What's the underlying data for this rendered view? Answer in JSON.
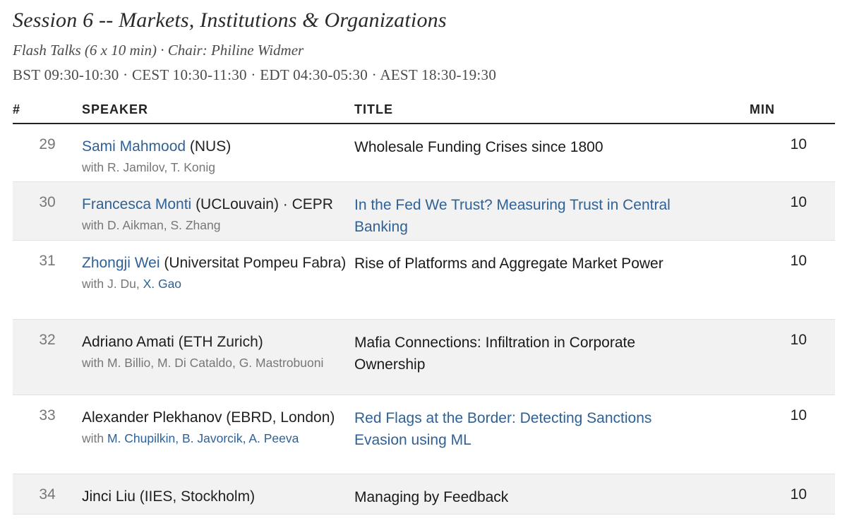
{
  "session": {
    "title": "Session 6 -- Markets, Institutions & Organizations",
    "subtitle": "Flash Talks (6 x 10 min) · Chair: Philine Widmer",
    "times": "BST 09:30-10:30 · CEST 10:30-11:30 · EDT 04:30-05:30 · AEST 18:30-19:30"
  },
  "table": {
    "headers": {
      "num": "#",
      "speaker": "SPEAKER",
      "title": "TITLE",
      "min": "MIN"
    },
    "rows": [
      {
        "num": "29",
        "speaker": "Sami Mahmood",
        "speaker_linked": true,
        "affiliation": " (NUS)",
        "with_prefix": "with ",
        "coauthors": "R. Jamilov, T. Konig",
        "coauthors_linked": false,
        "title": "Wholesale Funding Crises since 1800",
        "title_linked": false,
        "min": "10"
      },
      {
        "num": "30",
        "speaker": "Francesca Monti",
        "speaker_linked": true,
        "affiliation": " (UCLouvain) · CEPR",
        "with_prefix": "with ",
        "coauthors": "D. Aikman, S. Zhang",
        "coauthors_linked": false,
        "title": "In the Fed We Trust? Measuring Trust in Central Banking",
        "title_linked": true,
        "min": "10"
      },
      {
        "num": "31",
        "speaker": "Zhongji Wei",
        "speaker_linked": true,
        "affiliation": " (Universitat Pompeu Fabra)",
        "with_prefix": "with ",
        "coauthors": "J. Du, ",
        "coauthors_linked": false,
        "coauthors_link_part": "X. Gao",
        "title": "Rise of Platforms and Aggregate Market Power",
        "title_linked": false,
        "min": "10"
      },
      {
        "num": "32",
        "speaker": "Adriano Amati",
        "speaker_linked": false,
        "affiliation": " (ETH Zurich)",
        "with_prefix": "with ",
        "coauthors": "M. Billio, M. Di Cataldo, G. Mastrobuoni",
        "coauthors_linked": false,
        "title": "Mafia Connections: Infiltration in Corporate Ownership",
        "title_linked": false,
        "min": "10"
      },
      {
        "num": "33",
        "speaker": "Alexander Plekhanov",
        "speaker_linked": false,
        "affiliation": " (EBRD, London)",
        "with_prefix": "with ",
        "coauthors": "M. Chupilkin, B. Javorcik, A. Peeva",
        "coauthors_linked": true,
        "title": "Red Flags at the Border: Detecting Sanctions Evasion using ML",
        "title_linked": true,
        "min": "10"
      },
      {
        "num": "34",
        "speaker": "Jinci Liu",
        "speaker_linked": false,
        "affiliation": " (IIES, Stockholm)",
        "with_prefix": "",
        "coauthors": "",
        "coauthors_linked": false,
        "title": "Managing by Feedback",
        "title_linked": false,
        "min": "10"
      }
    ]
  },
  "colors": {
    "link": "#2f6196",
    "row_alt": "#f2f2f2",
    "muted": "#777777"
  }
}
